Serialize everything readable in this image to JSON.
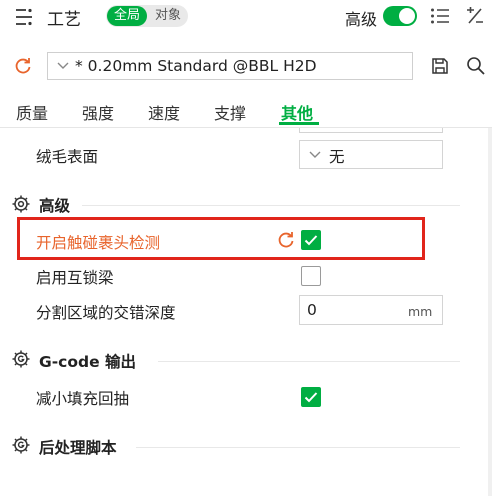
{
  "header": {
    "title": "工艺",
    "scope_global": "全局",
    "scope_object": "对象",
    "advanced_label": "高级",
    "advanced_enabled": true
  },
  "preset": {
    "value": "* 0.20mm Standard @BBL H2D"
  },
  "tabs": [
    "质量",
    "强度",
    "速度",
    "支撑",
    "其他"
  ],
  "active_tab": "其他",
  "settings": {
    "fuzzy_skin": {
      "label": "绒毛表面",
      "value": "无"
    },
    "advanced_section": {
      "title": "高级"
    },
    "enable_overhang_detection": {
      "label": "开启触碰裹头检测",
      "checked": true
    },
    "interlocking_beam": {
      "label": "启用互锁梁",
      "checked": false
    },
    "interlocking_depth": {
      "label": "分割区域的交错深度",
      "value": "0",
      "unit": "mm"
    },
    "gcode_section": {
      "title": "G-code 输出"
    },
    "reduce_infill_retraction": {
      "label": "减小填充回抽",
      "checked": true
    },
    "post_process_section": {
      "title": "后处理脚本"
    }
  },
  "colors": {
    "accent": "#00ae42",
    "modified": "#e8642c",
    "highlight_box": "#e1251b"
  }
}
